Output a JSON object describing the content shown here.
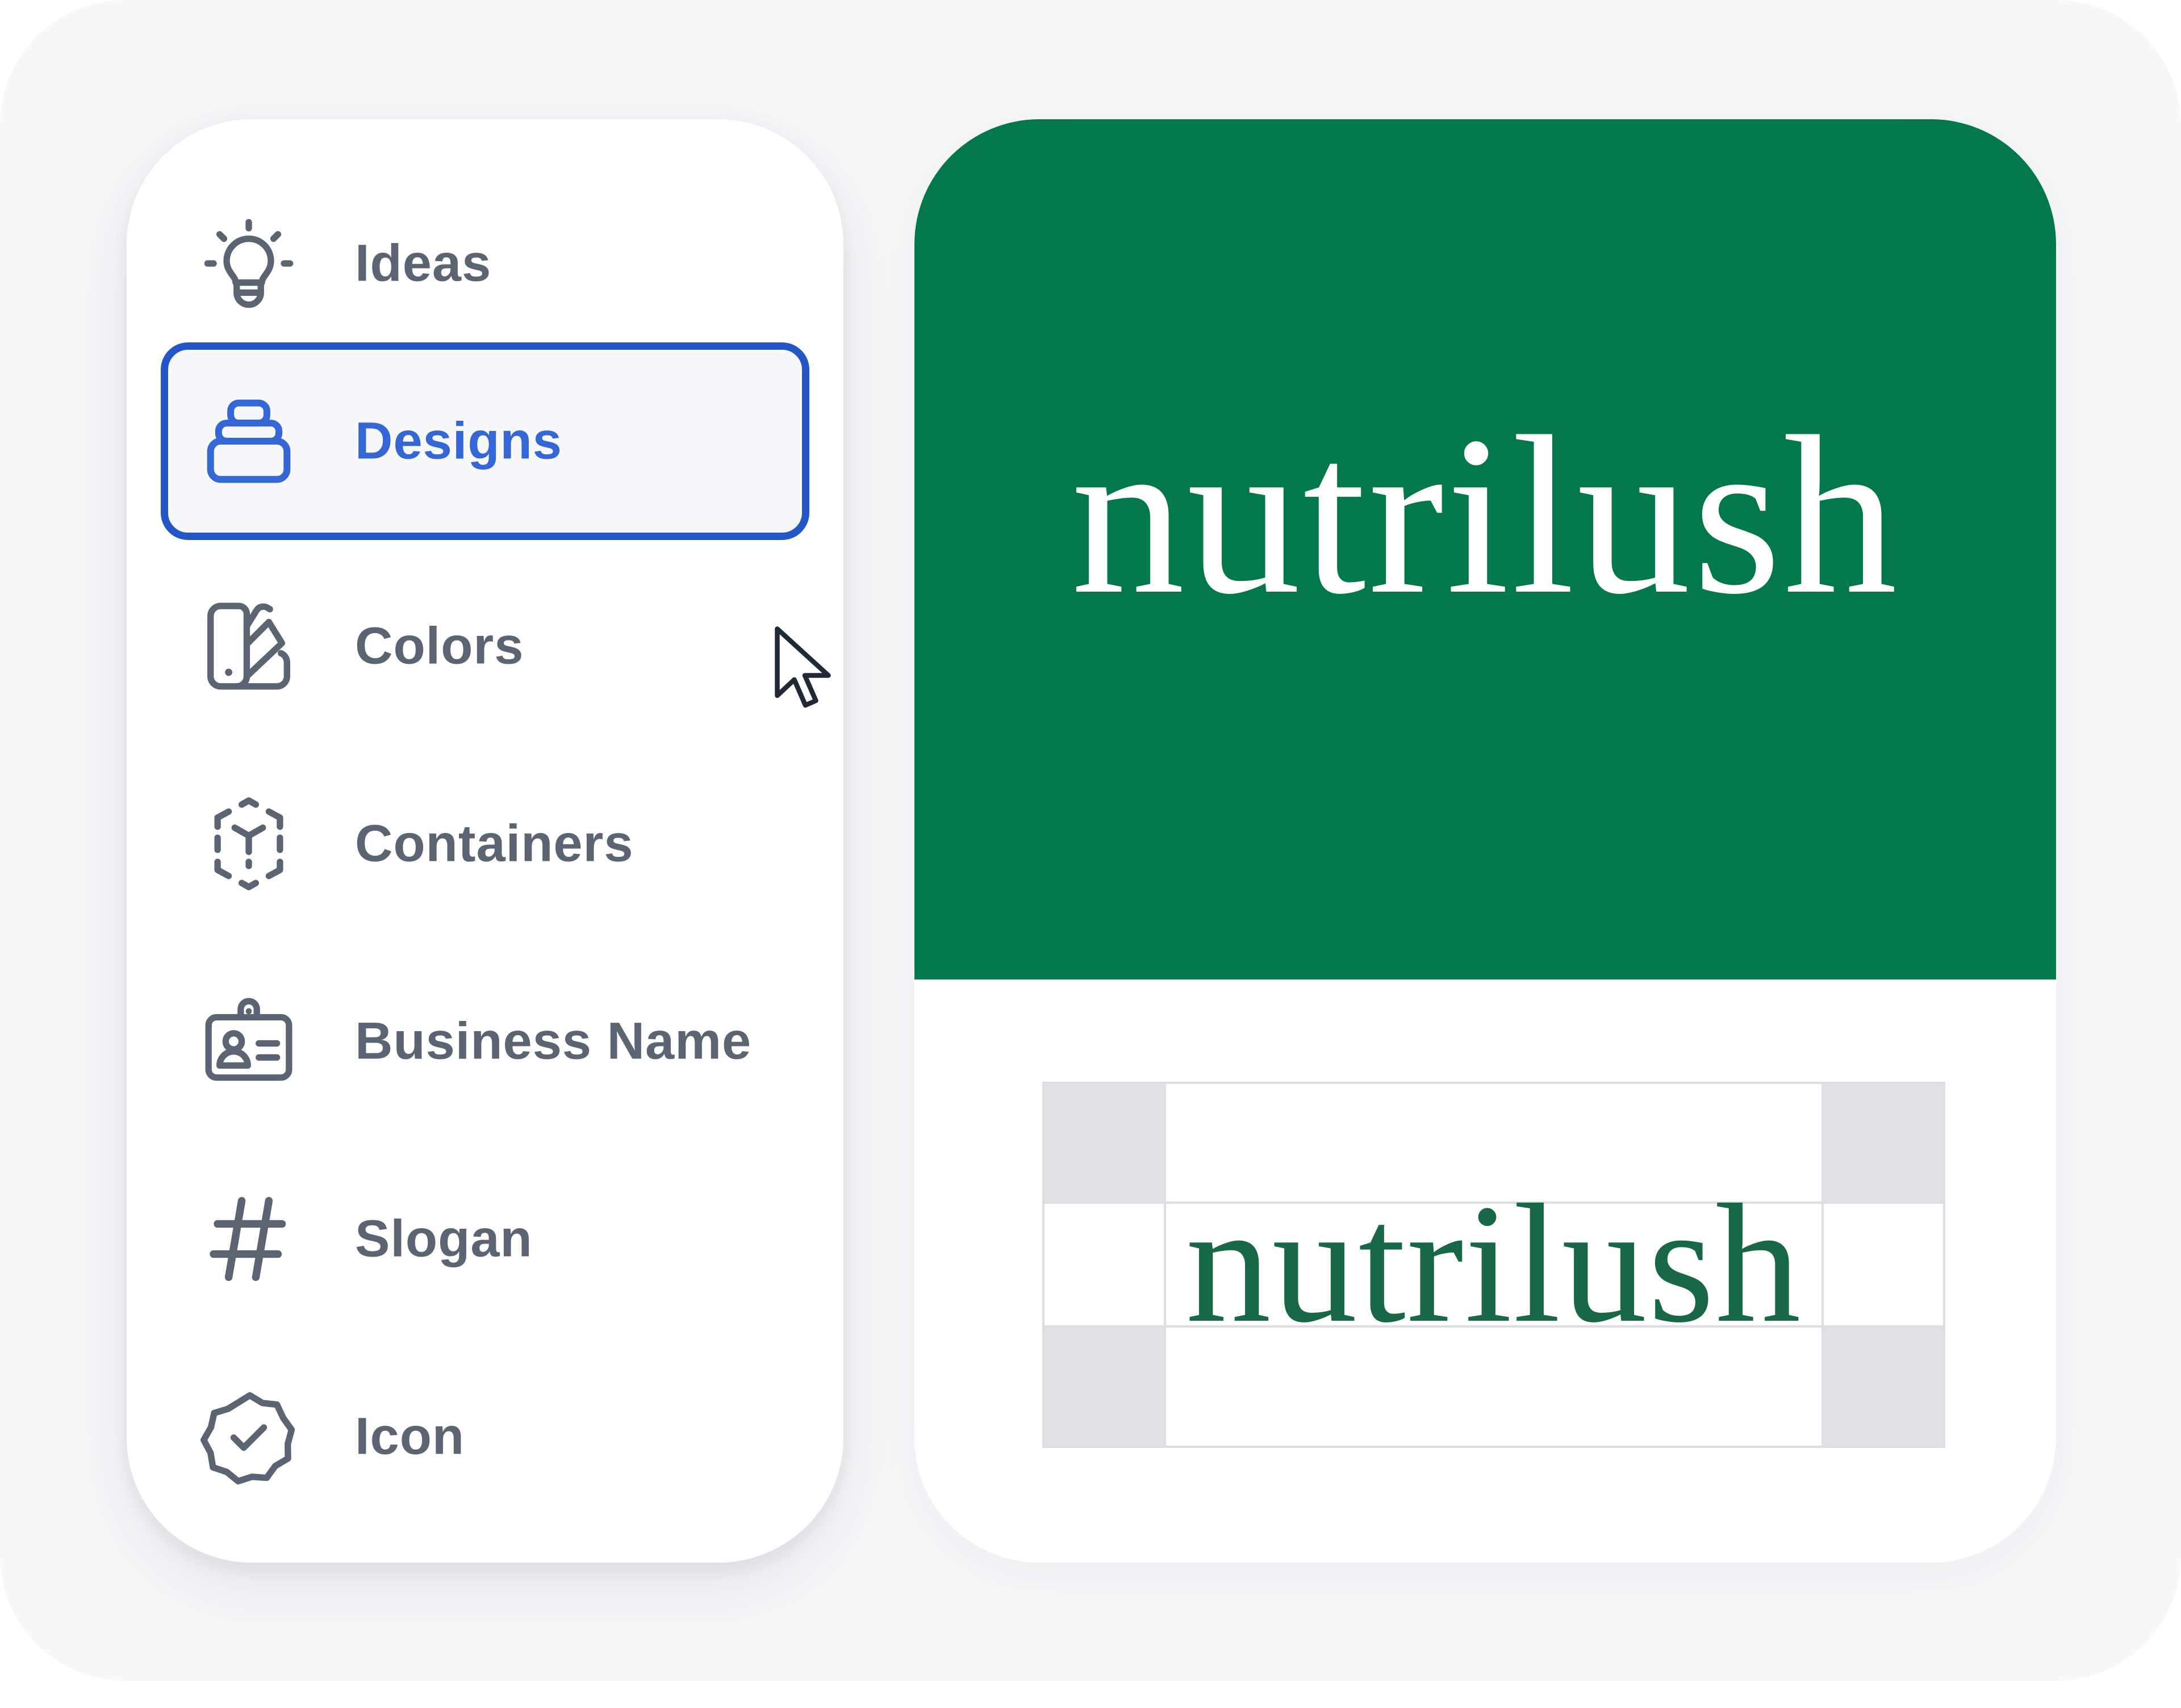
{
  "sidebar": {
    "items": [
      {
        "label": "Ideas",
        "icon": "lightbulb-icon",
        "active": false
      },
      {
        "label": "Designs",
        "icon": "layers-stack-icon",
        "active": true
      },
      {
        "label": "Colors",
        "icon": "color-swatch-icon",
        "active": false
      },
      {
        "label": "Containers",
        "icon": "dashed-cube-icon",
        "active": false
      },
      {
        "label": "Business Name",
        "icon": "id-card-icon",
        "active": false
      },
      {
        "label": "Slogan",
        "icon": "hashtag-icon",
        "active": false
      },
      {
        "label": "Icon",
        "icon": "verified-badge-icon",
        "active": false
      }
    ]
  },
  "preview": {
    "brand_name": "nutrilush",
    "hero_background": "#02784b",
    "hero_text_color": "#ffffff",
    "grid_text_color": "#186848"
  },
  "colors": {
    "accent": "#2456c8",
    "accent_text": "#3566d6",
    "nav_text": "#5b6472",
    "icon_stroke": "#5b6472"
  }
}
